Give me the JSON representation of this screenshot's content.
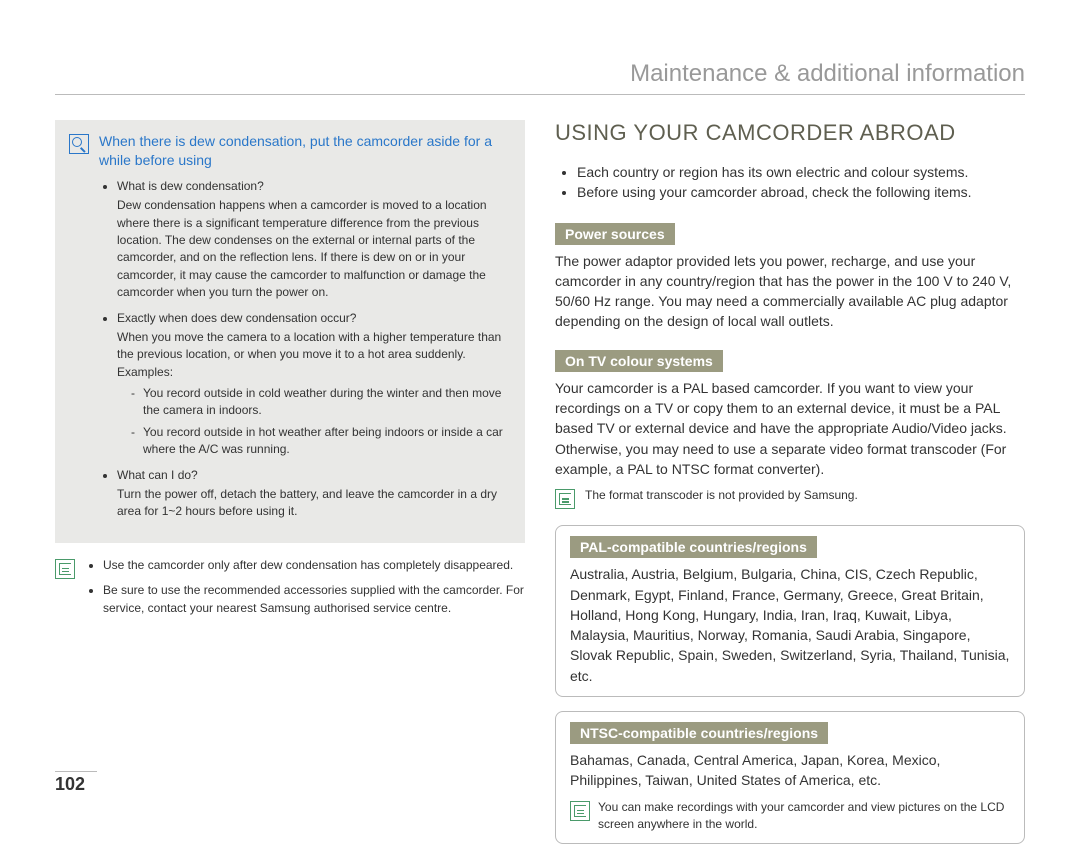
{
  "header": "Maintenance & additional information",
  "page_number": "102",
  "left_col": {
    "blue_heading": "When there is dew condensation, put the camcorder aside for a while before using",
    "items": [
      {
        "q": "What is dew condensation?",
        "a": "Dew condensation happens when a camcorder is moved to a location where there is a significant temperature difference from the previous location. The dew condenses on the external or internal parts of the camcorder, and on the reflection lens. If there is dew on or in your camcorder, it may cause the camcorder to malfunction or damage the camcorder when you turn the power on."
      },
      {
        "q": "Exactly when does dew condensation occur?",
        "a": "When you move the camera to a location with a higher temperature than the previous location, or when you move it to a hot area suddenly. Examples:",
        "dashed": [
          "You record outside in cold weather during the winter and then move the camera in indoors.",
          "You record outside in hot weather after being indoors or inside a car where the A/C was running."
        ]
      },
      {
        "q": "What can I do?",
        "a": "Turn the power off, detach the battery, and leave the camcorder in a dry area for 1~2 hours before using it."
      }
    ],
    "notes": [
      "Use the camcorder only after dew condensation has completely disappeared.",
      "Be sure to use the recommended accessories supplied with the camcorder. For service, contact your nearest Samsung authorised service centre."
    ]
  },
  "right_col": {
    "title": "USING YOUR CAMCORDER ABROAD",
    "intro_bullets": [
      "Each country or region has its own electric and colour systems.",
      "Before using your camcorder abroad, check the following items."
    ],
    "power_sources": {
      "tag": "Power sources",
      "text": "The power adaptor provided lets you power, recharge, and use your camcorder in any country/region that has the power in the 100 V to 240 V, 50/60 Hz range. You may need a commercially available AC plug adaptor depending on the design of local wall outlets."
    },
    "tv_colour": {
      "tag": "On TV colour systems",
      "text": "Your camcorder is a PAL based camcorder. If you want to view your recordings on a TV or copy them to an external device, it must be a PAL based TV or external device and have the appropriate Audio/Video jacks. Otherwise, you may need to use a separate video format transcoder (For example, a PAL to NTSC format converter).",
      "note": "The format transcoder is not provided by Samsung."
    },
    "pal_box": {
      "tag": "PAL-compatible countries/regions",
      "text": "Australia, Austria, Belgium, Bulgaria, China, CIS, Czech Republic, Denmark, Egypt, Finland, France, Germany, Greece, Great Britain, Holland, Hong Kong, Hungary, India, Iran, Iraq, Kuwait, Libya, Malaysia, Mauritius, Norway, Romania, Saudi Arabia, Singapore, Slovak Republic, Spain, Sweden, Switzerland, Syria, Thailand, Tunisia, etc."
    },
    "ntsc_box": {
      "tag": "NTSC-compatible countries/regions",
      "text": "Bahamas, Canada, Central America, Japan, Korea, Mexico, Philippines, Taiwan, United States of America, etc.",
      "note": "You can make recordings with your camcorder and view pictures on the LCD screen anywhere in the world."
    }
  }
}
